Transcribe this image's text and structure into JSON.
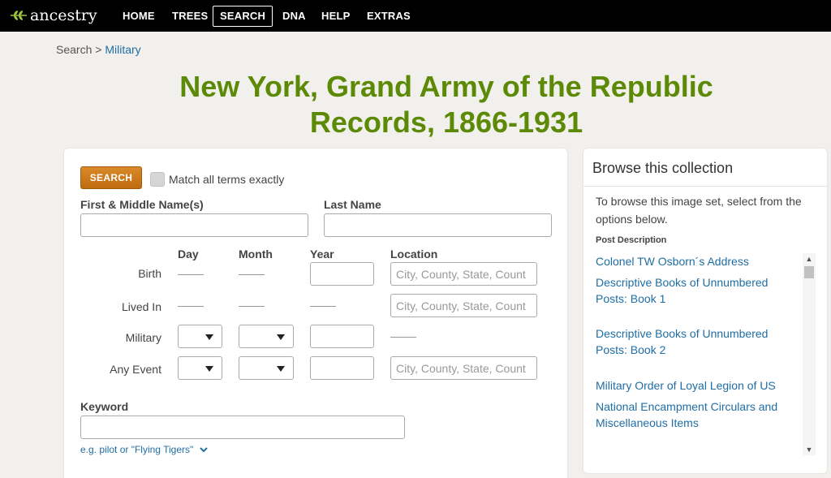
{
  "nav": {
    "logo_text": "ancestry",
    "items": [
      "HOME",
      "TREES",
      "SEARCH",
      "DNA",
      "HELP",
      "EXTRAS"
    ],
    "active": "SEARCH"
  },
  "breadcrumb": {
    "root": "Search",
    "separator": ">",
    "current": "Military"
  },
  "title": {
    "line1": "New York, Grand Army of the Republic",
    "line2": "Records, 1866-1931"
  },
  "form": {
    "search_button": "SEARCH",
    "match_exact_label": "Match all terms exactly",
    "first_name_label": "First & Middle Name(s)",
    "last_name_label": "Last Name",
    "columns": {
      "day": "Day",
      "month": "Month",
      "year": "Year",
      "location": "Location"
    },
    "rows": {
      "birth": "Birth",
      "lived_in": "Lived In",
      "military": "Military",
      "any_event": "Any Event"
    },
    "location_placeholder": "City, County, State, Count",
    "keyword_label": "Keyword",
    "keyword_hint": "e.g. pilot or \"Flying Tigers\""
  },
  "browse": {
    "title": "Browse this collection",
    "intro": "To browse this image set, select from the options below.",
    "subheading": "Post Description",
    "items": [
      "Colonel TW Osborn´s Address",
      "Descriptive Books of Unnumbered Posts: Book 1",
      "Descriptive Books of Unnumbered Posts: Book 2",
      "Military Order of Loyal Legion of US",
      "National Encampment Circulars and Miscellaneous Items"
    ]
  },
  "colors": {
    "brand_green": "#5c8a06",
    "link_blue": "#1f6da3",
    "button_orange": "#c97313",
    "nav_bg": "#000000"
  }
}
